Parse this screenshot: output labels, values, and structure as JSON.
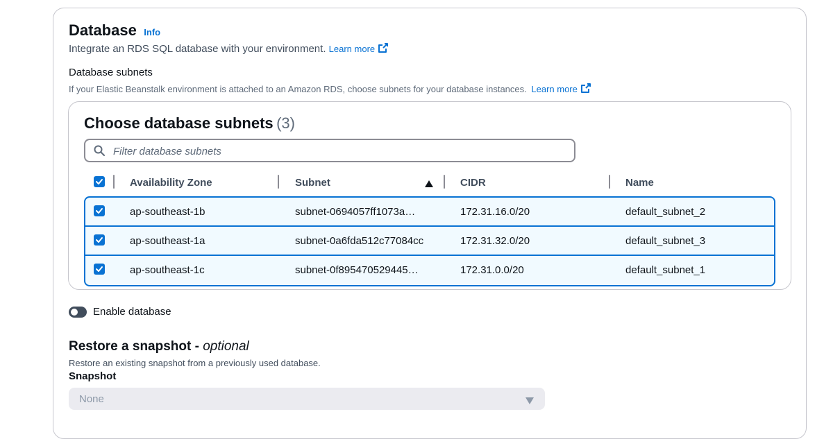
{
  "database": {
    "title": "Database",
    "info_label": "Info",
    "description": "Integrate an RDS SQL database with your environment.",
    "learn_more": "Learn more"
  },
  "subnets": {
    "label": "Database subnets",
    "description": "If your Elastic Beanstalk environment is attached to an Amazon RDS, choose subnets for your database instances.",
    "learn_more": "Learn more",
    "table": {
      "title": "Choose database subnets",
      "count": "(3)",
      "filter_placeholder": "Filter database subnets",
      "columns": [
        "Availability Zone",
        "Subnet",
        "CIDR",
        "Name"
      ],
      "sort_column": "Subnet",
      "sort_direction": "ascending",
      "rows": [
        {
          "az": "ap-southeast-1b",
          "subnet": "subnet-0694057ff1073a…",
          "cidr": "172.31.16.0/20",
          "name": "default_subnet_2",
          "selected": true
        },
        {
          "az": "ap-southeast-1a",
          "subnet": "subnet-0a6fda512c77084cc",
          "cidr": "172.31.32.0/20",
          "name": "default_subnet_3",
          "selected": true
        },
        {
          "az": "ap-southeast-1c",
          "subnet": "subnet-0f895470529445…",
          "cidr": "172.31.0.0/20",
          "name": "default_subnet_1",
          "selected": true
        }
      ]
    }
  },
  "enable_database": {
    "label": "Enable database",
    "enabled": false
  },
  "restore": {
    "title": "Restore a snapshot - ",
    "title_optional": "optional",
    "description": "Restore an existing snapshot from a previously used database.",
    "snapshot_label": "Snapshot",
    "snapshot_value": "None"
  },
  "colors": {
    "accent": "#0972d3",
    "row_selected_bg": "#f1faff",
    "toggle_off": "#414d5c",
    "disabled_bg": "#ebebf0"
  }
}
